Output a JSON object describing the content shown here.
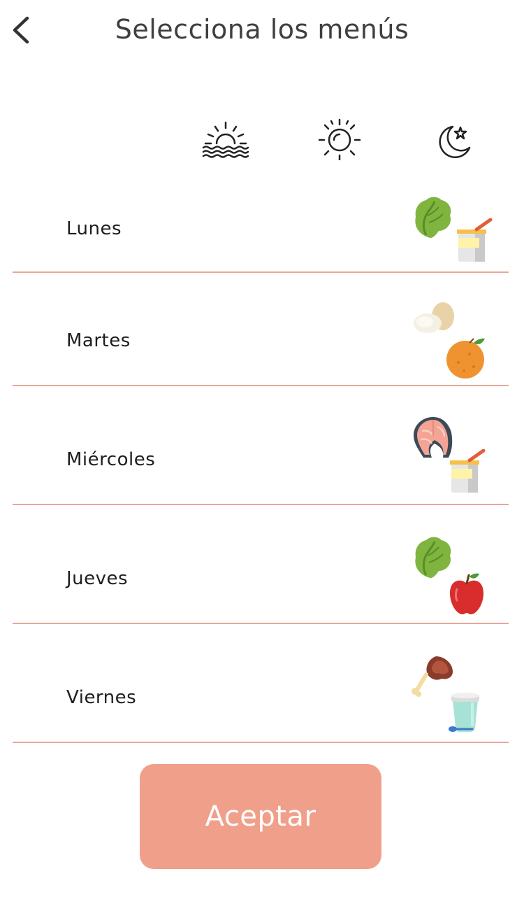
{
  "header": {
    "title": "Selecciona los menús"
  },
  "meal_icons": [
    "sunrise-icon",
    "sun-icon",
    "moon-star-icon"
  ],
  "days": [
    {
      "label": "Lunes",
      "foods": [
        "lettuce-icon",
        "yogurt-icon"
      ]
    },
    {
      "label": "Martes",
      "foods": [
        "eggs-icon",
        "orange-icon"
      ]
    },
    {
      "label": "Miércoles",
      "foods": [
        "salmon-steak-icon",
        "yogurt-icon"
      ]
    },
    {
      "label": "Jueves",
      "foods": [
        "lettuce-icon",
        "apple-icon"
      ]
    },
    {
      "label": "Viernes",
      "foods": [
        "ham-leg-icon",
        "yogurt-cup-icon"
      ]
    }
  ],
  "accept_button": {
    "label": "Aceptar"
  },
  "colors": {
    "accent": "#f0a08a",
    "divider": "#e8a897",
    "text": "#1e1e1e"
  }
}
